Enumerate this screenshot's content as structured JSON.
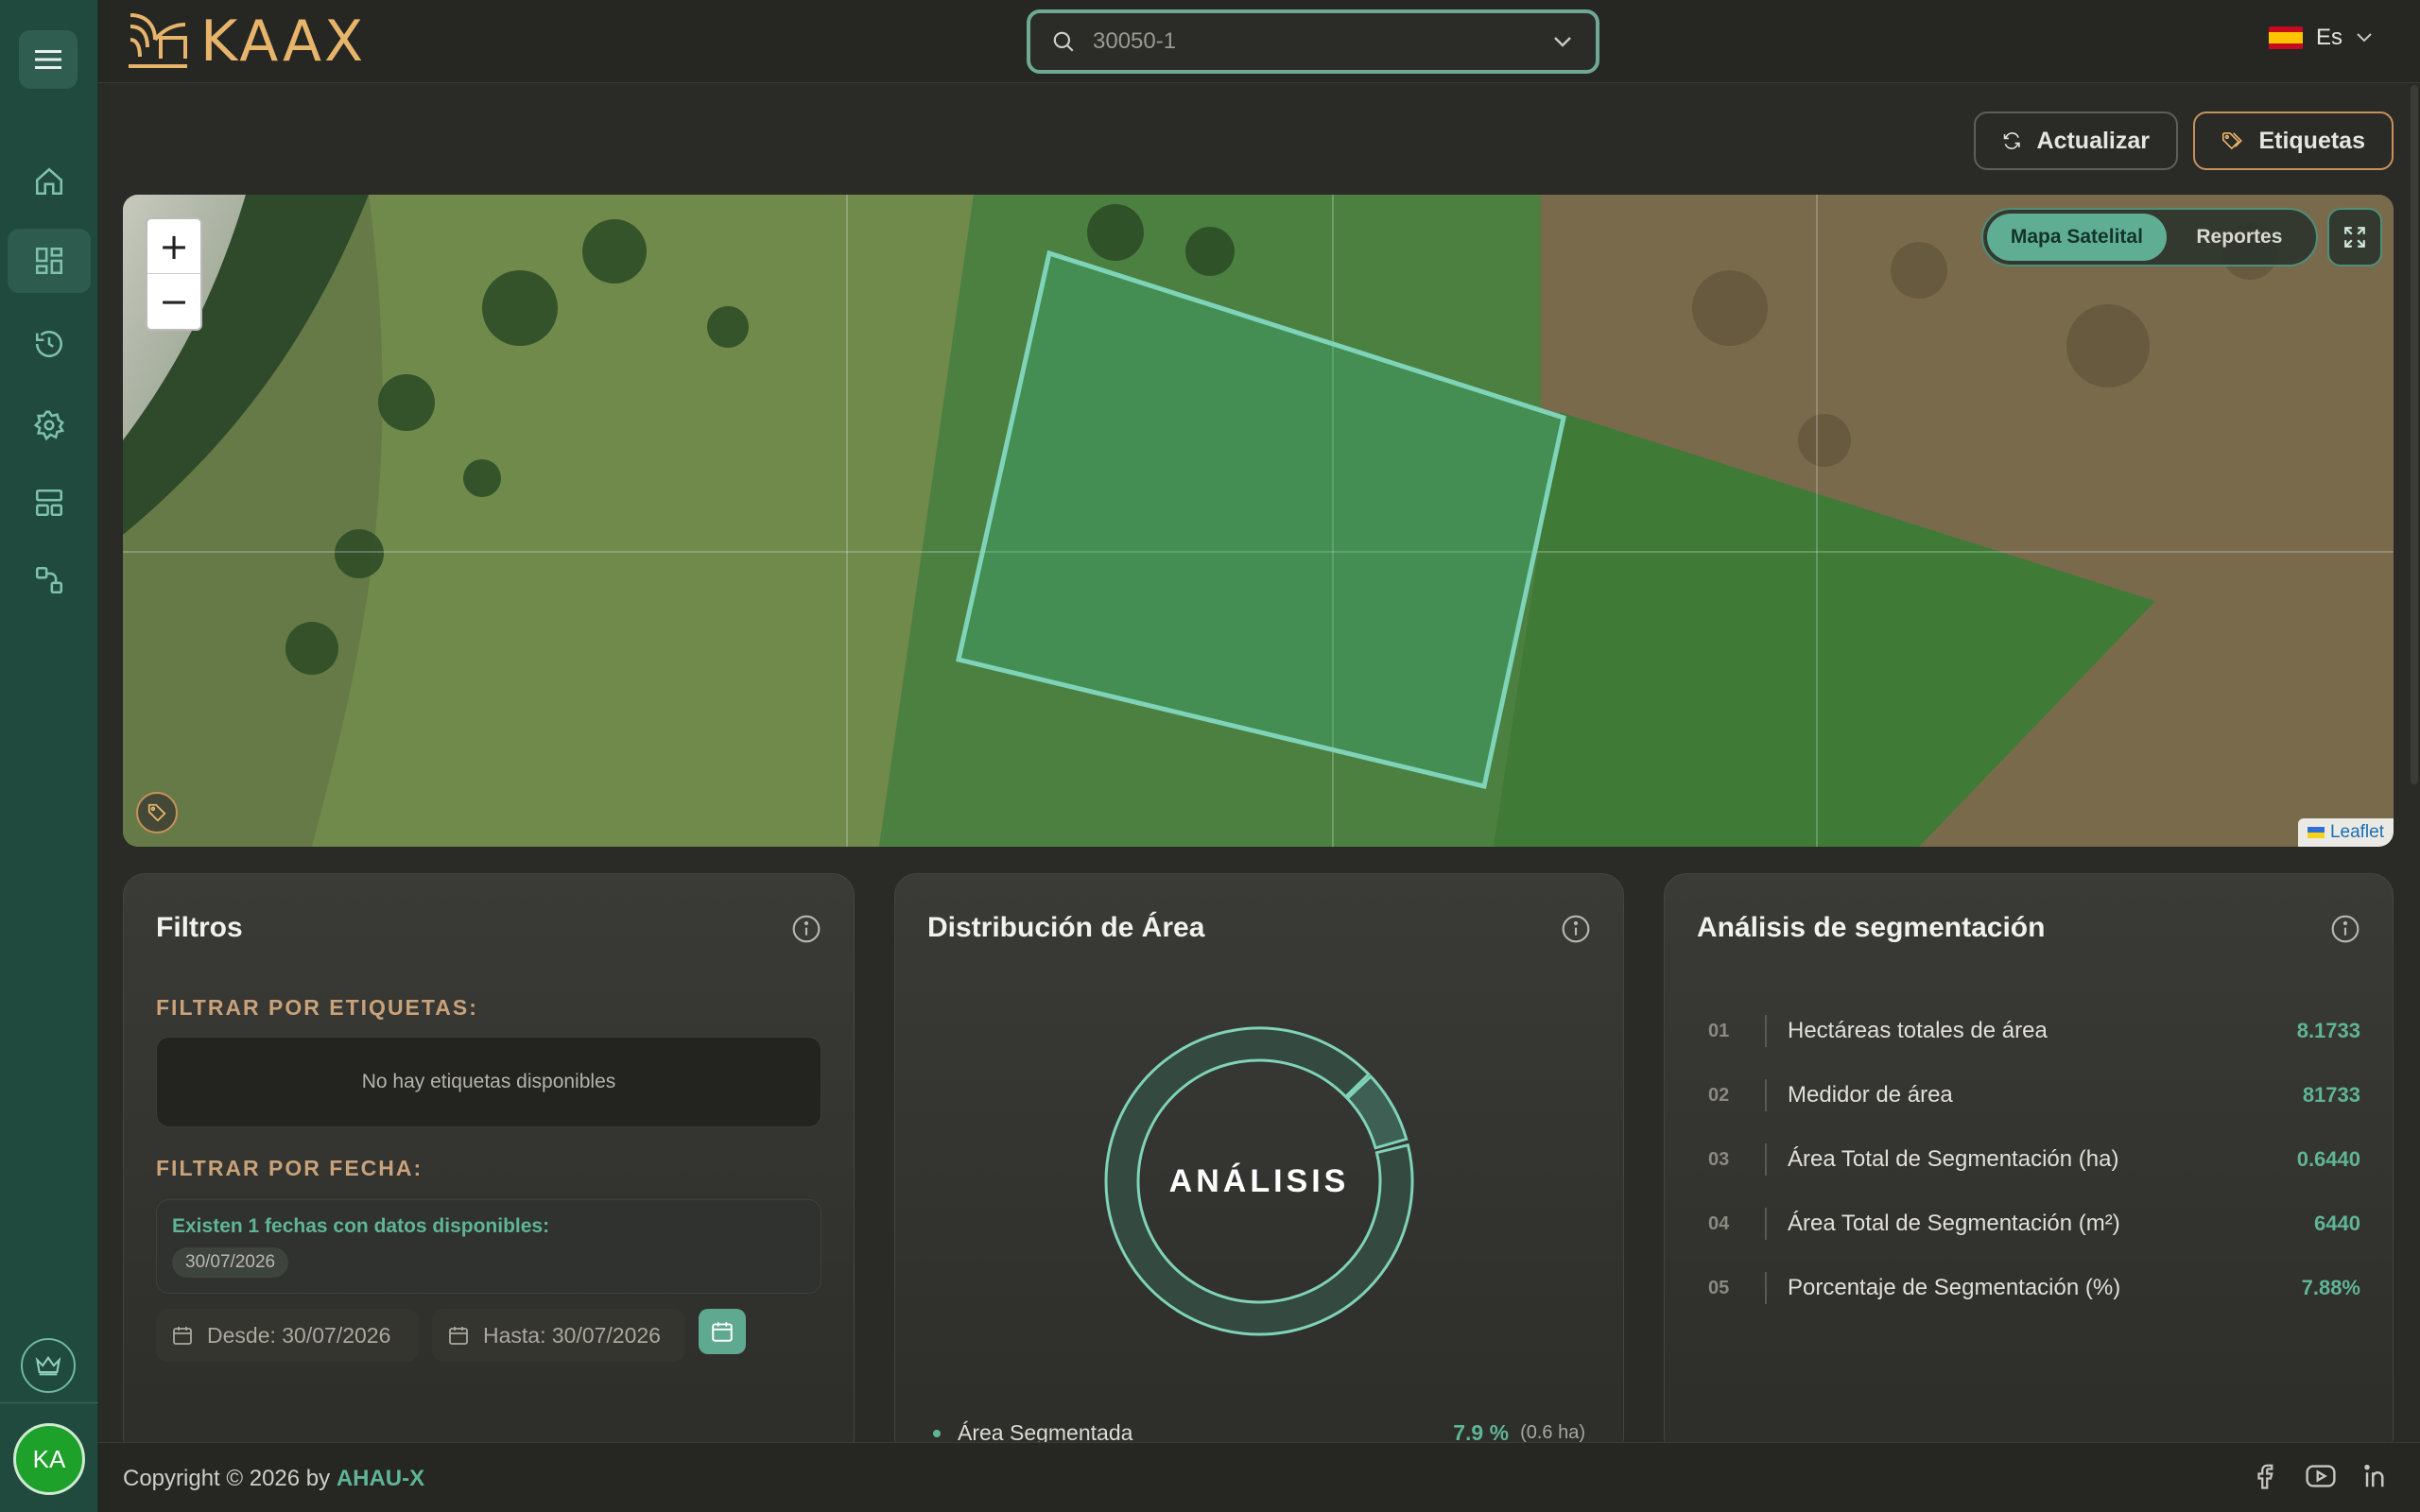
{
  "app": {
    "logo_text": "KAAX"
  },
  "header": {
    "search": {
      "value": "30050-1"
    },
    "language": "Es"
  },
  "toolbar": {
    "refresh_label": "Actualizar",
    "tags_label": "Etiquetas"
  },
  "map": {
    "toggle": {
      "satellite_label": "Mapa Satelital",
      "reports_label": "Reportes",
      "active": "Mapa Satelital"
    },
    "zoom_in": "+",
    "zoom_out": "−",
    "attribution": "Leaflet"
  },
  "filters": {
    "title": "Filtros",
    "tags_section": "FILTRAR POR ETIQUETAS:",
    "no_tags": "No hay etiquetas disponibles",
    "date_section": "FILTRAR POR FECHA:",
    "available_info": "Existen 1 fechas con datos disponibles:",
    "available_dates": [
      "30/07/2026"
    ],
    "from_label": "Desde: 30/07/2026",
    "to_label": "Hasta: 30/07/2026"
  },
  "distribution": {
    "title": "Distribución de Área",
    "center_label": "ANÁLISIS",
    "legend": [
      {
        "label": "Área Segmentada",
        "pct": "7.9 %",
        "ha": "(0.6 ha)"
      }
    ],
    "segmented_pct": 7.88
  },
  "segmentation": {
    "title": "Análisis de segmentación",
    "rows": [
      {
        "num": "01",
        "label": "Hectáreas totales de área",
        "value": "8.1733"
      },
      {
        "num": "02",
        "label": "Medidor de área",
        "value": "81733"
      },
      {
        "num": "03",
        "label": "Área Total de Segmentación (ha)",
        "value": "0.6440"
      },
      {
        "num": "04",
        "label": "Área Total de Segmentación (m²)",
        "value": "6440"
      },
      {
        "num": "05",
        "label": "Porcentaje de Segmentación (%)",
        "value": "7.88%"
      }
    ]
  },
  "footer": {
    "copyright": "Copyright © 2026 by ",
    "brand": "AHAU-X"
  },
  "user": {
    "initials": "KA"
  },
  "colors": {
    "accent": "#5fb596",
    "sidebar": "#1f4a3d",
    "gold": "#e7b46b"
  }
}
